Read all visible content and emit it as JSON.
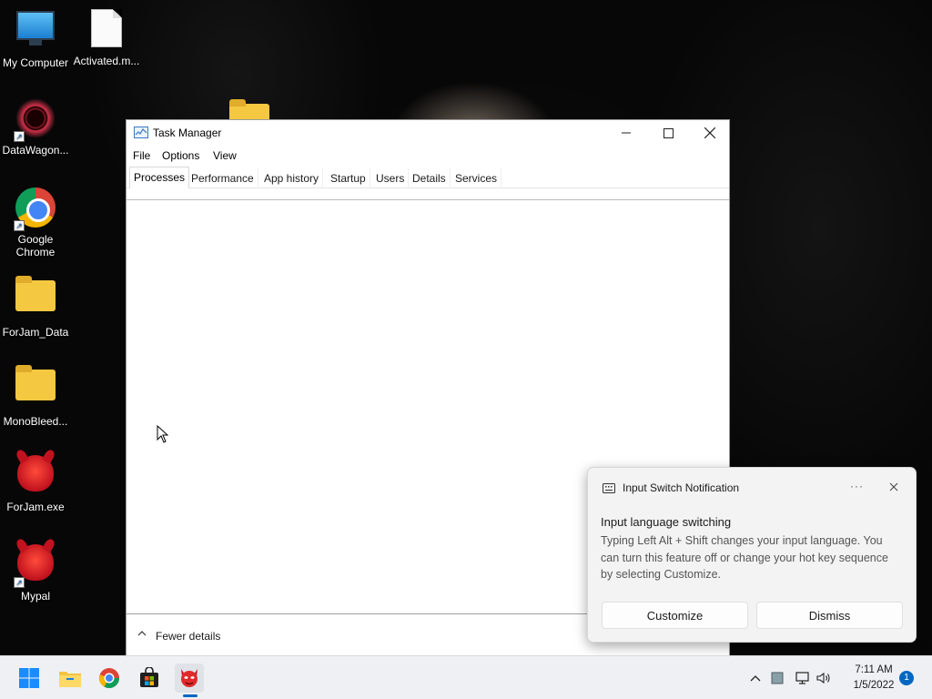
{
  "desktop": {
    "icons": [
      {
        "label": "My Computer",
        "icon": "monitor-icon"
      },
      {
        "label": "Activated.m...",
        "icon": "document-icon"
      },
      {
        "label": "DataWagon...",
        "icon": "datawagon-icon"
      },
      {
        "label": "Google Chrome",
        "icon": "chrome-icon"
      },
      {
        "label": "ForJam_Data",
        "icon": "folder-icon"
      },
      {
        "label": "MonoBleed...",
        "icon": "folder-icon"
      },
      {
        "label": "ForJam.exe",
        "icon": "mascot-icon"
      },
      {
        "label": "Mypal",
        "icon": "mascot-icon"
      }
    ]
  },
  "task_manager": {
    "title": "Task Manager",
    "menu": [
      "File",
      "Options",
      "View"
    ],
    "tabs": [
      "Processes",
      "Performance",
      "App history",
      "Startup",
      "Users",
      "Details",
      "Services"
    ],
    "active_tab": "Processes",
    "footer": {
      "fewer_details": "Fewer details"
    }
  },
  "notification": {
    "app_name": "Input Switch Notification",
    "more_label": "···",
    "heading": "Input language switching",
    "body": "Typing Left Alt + Shift changes your input language. You can turn this feature off or change your hot key sequence by selecting Customize.",
    "buttons": {
      "customize": "Customize",
      "dismiss": "Dismiss"
    }
  },
  "taskbar": {
    "apps": [
      "start-icon",
      "file-explorer-icon",
      "chrome-icon",
      "store-icon",
      "task-manager-mascot-icon"
    ],
    "tray": {
      "time": "7:11 AM",
      "date": "1/5/2022",
      "notification_count": "1"
    }
  },
  "colors": {
    "accent": "#0067c0",
    "taskbar_bg": "#eef0f3",
    "toast_bg": "#f3f3f3"
  }
}
